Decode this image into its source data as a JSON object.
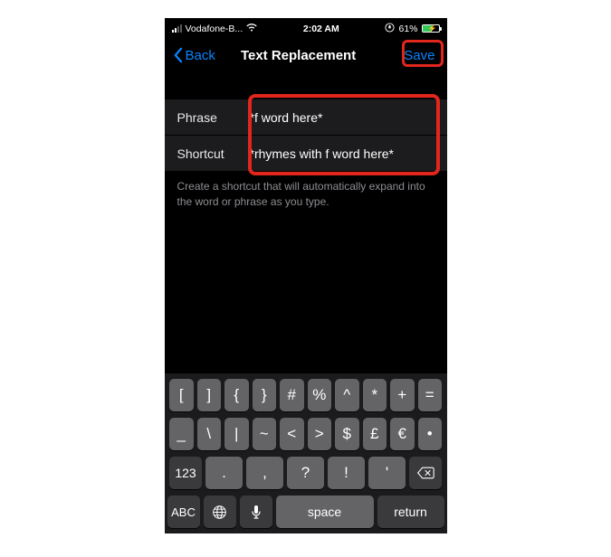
{
  "status": {
    "carrier": "Vodafone-B...",
    "time": "2:02 AM",
    "battery_pct": "61%"
  },
  "nav": {
    "back_label": "Back",
    "title": "Text Replacement",
    "save_label": "Save"
  },
  "form": {
    "phrase_label": "Phrase",
    "phrase_value": "*f word here*",
    "shortcut_label": "Shortcut",
    "shortcut_value": "*rhymes with f word here*",
    "footer": "Create a shortcut that will automatically expand into the word or phrase as you type."
  },
  "keyboard": {
    "row1": [
      "[",
      "]",
      "{",
      "}",
      "#",
      "%",
      "^",
      "*",
      "+",
      "="
    ],
    "row2": [
      "_",
      "\\",
      "|",
      "~",
      "<",
      ">",
      "$",
      "£",
      "€",
      "•"
    ],
    "mode123": "123",
    "row3": [
      ".",
      ",",
      "?",
      "!",
      "'"
    ],
    "modeABC": "ABC",
    "space": "space",
    "return": "return"
  }
}
